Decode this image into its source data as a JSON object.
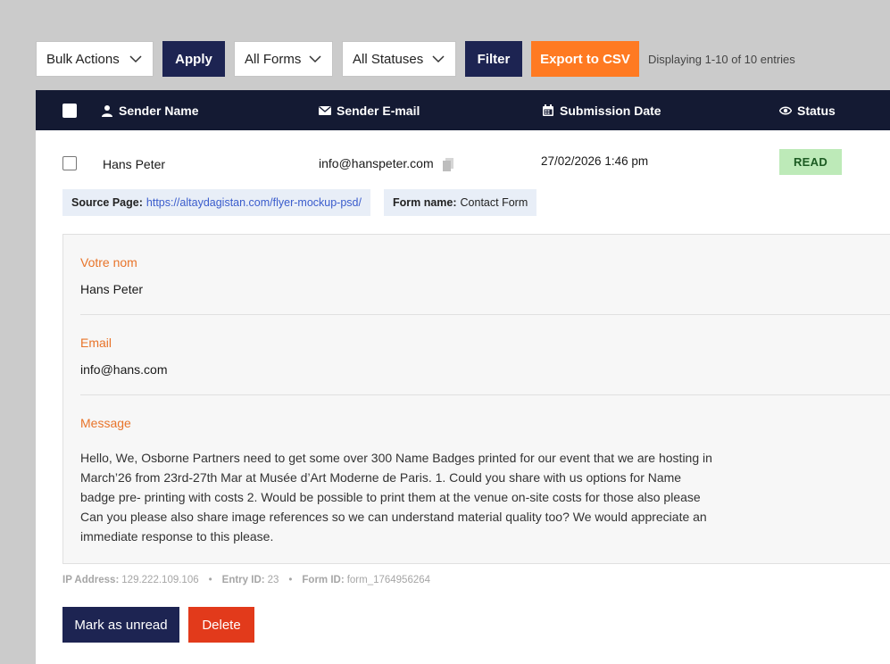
{
  "toolbar": {
    "bulk_actions": "Bulk Actions",
    "apply": "Apply",
    "all_forms": "All Forms",
    "all_statuses": "All Statuses",
    "filter": "Filter",
    "export": "Export to CSV",
    "display_text": "Displaying 1-10 of 10 entries"
  },
  "table": {
    "headers": {
      "sender_name": "Sender Name",
      "sender_email": "Sender E-mail",
      "submission_date": "Submission Date",
      "status": "Status"
    },
    "row": {
      "name": "Hans Peter",
      "email": "info@hanspeter.com",
      "date": "27/02/2026 1:46 pm",
      "status": "READ"
    }
  },
  "source": {
    "label": "Source Page:",
    "url": "https://altaydagistan.com/flyer-mockup-psd/",
    "form_label": "Form name:",
    "form_name": "Contact Form"
  },
  "fields": [
    {
      "label": "Votre nom",
      "value": "Hans Peter"
    },
    {
      "label": "Email",
      "value": "info@hans.com"
    },
    {
      "label": "Message",
      "value": "Hello, We, Osborne Partners need to get some over 300 Name Badges printed for our event that we are hosting in March’26 from 23rd-27th Mar at Musée d’Art Moderne de Paris. 1. Could you share with us options for Name badge pre- printing with costs 2. Would be possible to print them at the venue on-site costs for those also please Can you please also share image references so we can understand material quality too? We would appreciate an immediate response to this please."
    }
  ],
  "meta": {
    "ip_label": "IP Address:",
    "ip": "129.222.109.106",
    "entry_label": "Entry ID:",
    "entry": "23",
    "form_id_label": "Form ID:",
    "form_id": "form_1764956264",
    "separator": "•"
  },
  "actions": {
    "mark_unread": "Mark as unread",
    "delete": "Delete"
  },
  "colors": {
    "navy": "#1d2452",
    "header": "#141a33",
    "orange": "#ff7a22",
    "delete_red": "#e23a1b",
    "label_orange": "#e8742a",
    "read_badge": "#bdeab8"
  }
}
